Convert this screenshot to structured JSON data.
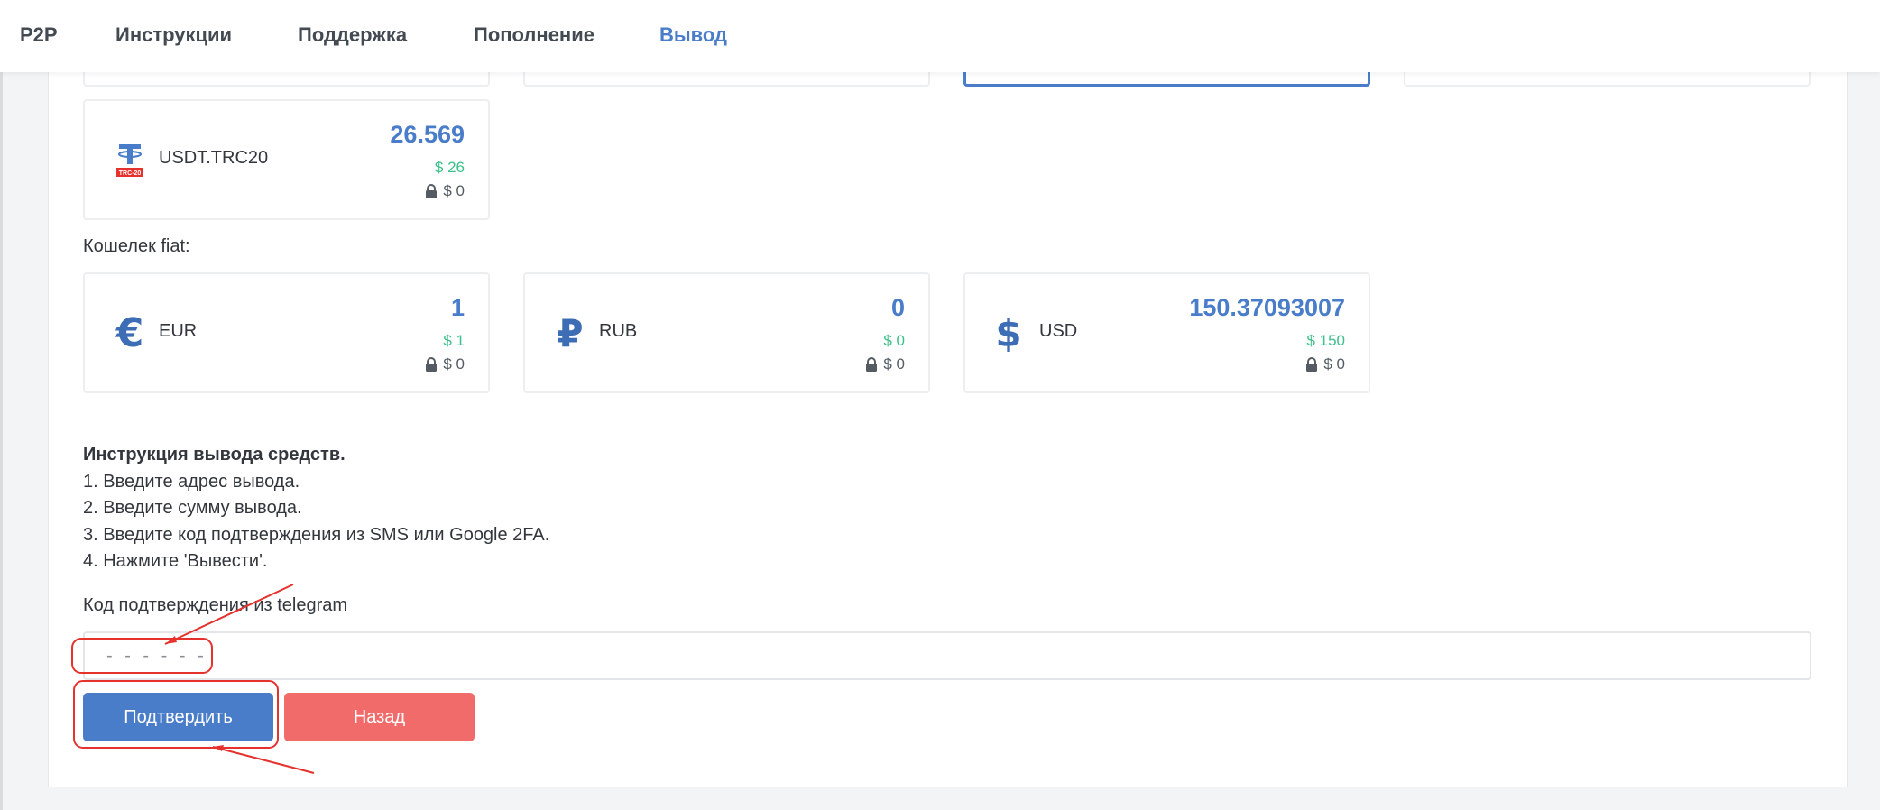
{
  "nav": {
    "items": [
      {
        "label": "P2P"
      },
      {
        "label": "Инструкции"
      },
      {
        "label": "Поддержка"
      },
      {
        "label": "Пополнение"
      },
      {
        "label": "Вывод"
      }
    ],
    "active_index": 4
  },
  "crypto_wallets": [
    {
      "name": "USDT.TRC20",
      "amount": "26.569",
      "usd": "$ 26",
      "locked": "$ 0",
      "icon": "usdt-trc20-icon"
    }
  ],
  "fiat_section_label": "Кошелек fiat:",
  "fiat_wallets": [
    {
      "name": "EUR",
      "amount": "1",
      "usd": "$ 1",
      "locked": "$ 0",
      "icon": "euro-icon"
    },
    {
      "name": "RUB",
      "amount": "0",
      "usd": "$ 0",
      "locked": "$ 0",
      "icon": "ruble-icon"
    },
    {
      "name": "USD",
      "amount": "150.37093007",
      "usd": "$ 150",
      "locked": "$ 0",
      "icon": "dollar-icon"
    }
  ],
  "instructions": {
    "title": "Инструкция вывода средств.",
    "steps": [
      "1. Введите адрес вывода.",
      "2. Введите сумму вывода.",
      "3. Введите код подтверждения из SMS или Google 2FA.",
      "4. Нажмите 'Вывести'."
    ]
  },
  "code_field": {
    "label": "Код подтверждения из telegram",
    "placeholder": "- - - - - -",
    "value": ""
  },
  "buttons": {
    "confirm": "Подтвердить",
    "back": "Назад"
  },
  "icon_badge_text": "TRC-20",
  "colors": {
    "accent": "#4a7dc9",
    "positive": "#3cbf8a",
    "danger": "#f26b6b",
    "annotation": "#e5322d"
  }
}
